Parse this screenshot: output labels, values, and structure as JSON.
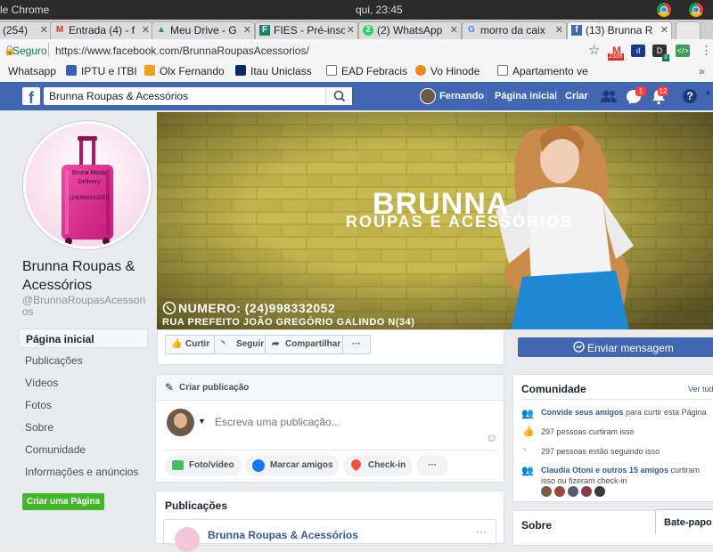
{
  "os": {
    "app": "le Chrome",
    "clock": "qui, 23:45"
  },
  "tabs": [
    {
      "label": "(254)",
      "active": false
    },
    {
      "label": "Entrada (4) - f",
      "active": false
    },
    {
      "label": "Meu Drive - G",
      "active": false
    },
    {
      "label": "FIES - Pré-insc",
      "active": false
    },
    {
      "label": "(2) WhatsApp",
      "active": false
    },
    {
      "label": "morro da caix",
      "active": false
    },
    {
      "label": "(13) Brunna R",
      "active": true
    }
  ],
  "address": {
    "secure_label": "Seguro",
    "url": "https://www.facebook.com/BrunnaRoupasAcessorios/",
    "gmail_count": "2336",
    "ext_count": "3"
  },
  "bookmarks": [
    "Whatsapp",
    "IPTU e ITBI",
    "Olx Fernando",
    "Itau Uniclass",
    "EAD Febracis",
    "Vo Hinode",
    "Apartamento ve"
  ],
  "fb": {
    "search_value": "Brunna Roupas & Acessórios",
    "user": "Fernando",
    "home": "Página inicial",
    "create": "Criar",
    "messages_badge": "1",
    "notifications_badge": "12"
  },
  "page": {
    "name": "Brunna Roupas & Acessórios",
    "handle": "@BrunnaRoupasAcessorios",
    "profile_texts": [
      "Bruna Moda",
      "Delivery",
      "(24)998332052"
    ],
    "nav": [
      "Página inicial",
      "Publicações",
      "Vídeos",
      "Fotos",
      "Sobre",
      "Comunidade",
      "Informações e anúncios"
    ],
    "create_page": "Criar uma Página"
  },
  "cover": {
    "title": "BRUNNA",
    "subtitle": "ROUPAS E ACESSÓRIOS",
    "phone": "NUMERO: (24)998332052",
    "address": "RUA PREFEITO JOÃO GREGÓRIO GALINDO N(34)"
  },
  "actions": {
    "like": "Curtir",
    "follow": "Seguir",
    "share": "Compartilhar",
    "more": "···",
    "message": "Enviar mensagem"
  },
  "composer": {
    "header": "Criar publicação",
    "placeholder": "Escreva uma publicação...",
    "photo": "Foto/vídeo",
    "tag": "Marcar amigos",
    "checkin": "Check-in",
    "more": "···"
  },
  "publications": {
    "title": "Publicações",
    "first_post_author": "Brunna Roupas & Acessórios"
  },
  "community": {
    "title": "Comunidade",
    "see_all": "Ver tud",
    "invite_link": "Convide seus amigos",
    "invite_rest": "para curtir esta Página",
    "likes": "297 pessoas curtiram isso",
    "follows": "297 pessoas estão seguindo isso",
    "checkin_link": "Claudia Otoni e outros 15 amigos",
    "checkin_rest_1": "curtiram",
    "checkin_rest_2": "isso ou fizeram check-in"
  },
  "about": {
    "title": "Sobre"
  },
  "chat": {
    "label": "Bate-papo -"
  }
}
